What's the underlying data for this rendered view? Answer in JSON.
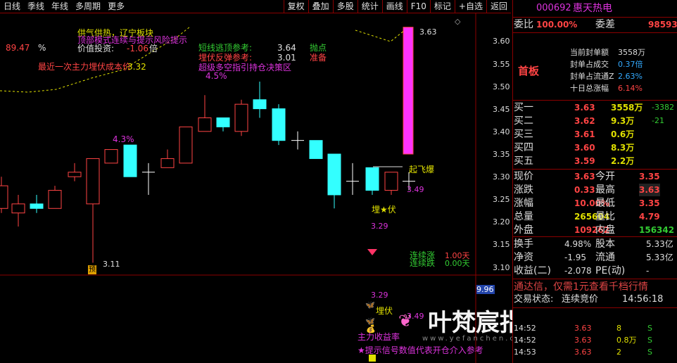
{
  "toolbar": {
    "left": [
      "日线",
      "季线",
      "年线",
      "多周期",
      "更多"
    ],
    "right": [
      "复权",
      "叠加",
      "多股",
      "统计",
      "画线",
      "F10",
      "标记",
      "+自选",
      "返回"
    ]
  },
  "overlay_text": {
    "l1": "供气供热，辽宁板块",
    "l2": "顶部模式连续与提示风险提示",
    "l3_label": "价值投资:",
    "l3_value": "-1.06",
    "l3_unit": "倍",
    "left_num": "89.47",
    "left_pct": "%",
    "cost": "最近一次主力埋伏成本价",
    "cost_val": "3.32",
    "s1_label": "短线逃顶参考:",
    "s1_val": "3.64",
    "s1_tag": "抛点",
    "s2_label": "埋伏反弹参考:",
    "s2_val": "3.01",
    "s2_tag": "准备",
    "s3": "超级多空指引持仓决策区",
    "pct1": "4.5%",
    "pct2": "4.3%",
    "high_label": "3.63",
    "low_label": "3.11",
    "qifei": "起飞爆",
    "v349": "3.49",
    "maifu": "埋★伏",
    "v329": "3.29",
    "lianxuzhang": "连续涨",
    "lianxuzhang_v": "1.00天",
    "lianxudie": "连续跌",
    "lianxudie_v": "0.00天",
    "yu": "预",
    "lower_v329": "3.29",
    "lower_maifu": "埋伏",
    "lower_349": "3.49",
    "zhushou": "主力收益率",
    "tips": "★提示信号数值代表开仓介入参考",
    "right_low": "9.96",
    "watermark": "叶梵宸指标公式网",
    "watermark_url": "www.yefanchen.com"
  },
  "yaxis": [
    "3.60",
    "3.55",
    "3.50",
    "3.45",
    "3.40",
    "3.35",
    "3.30",
    "3.25",
    "3.20",
    "3.15",
    "3.10"
  ],
  "panel": {
    "code": "000692",
    "name": "惠天热电",
    "weibi_label": "委比",
    "weibi": "100.00%",
    "weicha_label": "委差",
    "weicha": "98593",
    "shouban": "首板",
    "info": [
      {
        "k": "当前封单额",
        "v": "3558万"
      },
      {
        "k": "封单占成交",
        "v": "0.37倍"
      },
      {
        "k": "封单占流通Z",
        "v": "2.63%"
      },
      {
        "k": "十日总涨幅",
        "v": "6.14%"
      }
    ],
    "buys": [
      {
        "k": "买一",
        "p": "3.63",
        "v": "3558万",
        "d": "-3382"
      },
      {
        "k": "买二",
        "p": "3.62",
        "v": "9.3万",
        "d": "-21"
      },
      {
        "k": "买三",
        "p": "3.61",
        "v": "0.6万",
        "d": ""
      },
      {
        "k": "买四",
        "p": "3.60",
        "v": "8.3万",
        "d": ""
      },
      {
        "k": "买五",
        "p": "3.59",
        "v": "2.2万",
        "d": ""
      }
    ],
    "stats": [
      {
        "a": "现价",
        "av": "3.63",
        "b": "今开",
        "bv": "3.35"
      },
      {
        "a": "涨跌",
        "av": "0.33",
        "b": "最高",
        "bv": "3.63"
      },
      {
        "a": "涨幅",
        "av": "10.00%",
        "b": "最低",
        "bv": "3.35"
      },
      {
        "a": "总量",
        "av": "265604",
        "b": "量比",
        "bv": "4.79"
      },
      {
        "a": "外盘",
        "av": "109262",
        "b": "内盘",
        "bv": "156342"
      }
    ],
    "stats2": [
      {
        "a": "换手",
        "av": "4.98%",
        "b": "股本",
        "bv": "5.33亿"
      },
      {
        "a": "净资",
        "av": "-1.95",
        "b": "流通",
        "bv": "5.33亿"
      },
      {
        "a": "收益(二)",
        "av": "-2.078",
        "b": "PE(动)",
        "bv": "-"
      }
    ],
    "promo": "通达信，仅需1元查看千档行情",
    "trade_label": "交易状态:",
    "trade_state": "连续竞价",
    "trade_time": "14:56:18",
    "ticks": [
      {
        "t": "14:52",
        "p": "3.63",
        "v": "8",
        "f": "S"
      },
      {
        "t": "14:52",
        "p": "3.63",
        "v": "0.8万",
        "f": "S"
      },
      {
        "t": "14:53",
        "p": "3.63",
        "v": "2",
        "f": "S"
      }
    ]
  },
  "chart_data": {
    "type": "candlestick",
    "ylim": [
      3.08,
      3.66
    ],
    "candles": [
      {
        "o": 3.23,
        "c": 3.28,
        "h": 3.3,
        "l": 3.22
      },
      {
        "o": 3.22,
        "c": 3.24,
        "h": 3.26,
        "l": 3.19
      },
      {
        "o": 3.24,
        "c": 3.23,
        "h": 3.26,
        "l": 3.22
      },
      {
        "o": 3.23,
        "c": 3.27,
        "h": 3.28,
        "l": 3.23
      },
      {
        "o": 3.3,
        "c": 3.31,
        "h": 3.33,
        "l": 3.29
      },
      {
        "o": 3.24,
        "c": 3.34,
        "h": 3.34,
        "l": 3.11
      },
      {
        "o": 3.33,
        "c": 3.36,
        "h": 3.36,
        "l": 3.33
      },
      {
        "o": 3.37,
        "c": 3.3,
        "h": 3.37,
        "l": 3.3
      },
      {
        "o": 3.31,
        "c": 3.31,
        "h": 3.33,
        "l": 3.26
      },
      {
        "o": 3.32,
        "c": 3.34,
        "h": 3.36,
        "l": 3.32
      },
      {
        "o": 3.33,
        "c": 3.41,
        "h": 3.41,
        "l": 3.33
      },
      {
        "o": 3.4,
        "c": 3.43,
        "h": 3.48,
        "l": 3.4
      },
      {
        "o": 3.43,
        "c": 3.41,
        "h": 3.43,
        "l": 3.4
      },
      {
        "o": 3.4,
        "c": 3.46,
        "h": 3.47,
        "l": 3.39
      },
      {
        "o": 3.47,
        "c": 3.45,
        "h": 3.51,
        "l": 3.43
      },
      {
        "o": 3.45,
        "c": 3.38,
        "h": 3.46,
        "l": 3.37
      },
      {
        "o": 3.38,
        "c": 3.38,
        "h": 3.4,
        "l": 3.36
      },
      {
        "o": 3.38,
        "c": 3.34,
        "h": 3.38,
        "l": 3.34
      },
      {
        "o": 3.35,
        "c": 3.26,
        "h": 3.35,
        "l": 3.23
      },
      {
        "o": 3.29,
        "c": 3.29,
        "h": 3.33,
        "l": 3.26
      },
      {
        "o": 3.32,
        "c": 3.27,
        "h": 3.32,
        "l": 3.26
      },
      {
        "o": 3.27,
        "c": 3.31,
        "h": 3.31,
        "l": 3.26
      },
      {
        "o": 3.29,
        "c": 3.29,
        "h": 3.31,
        "l": 3.27
      },
      {
        "o": 3.35,
        "c": 3.63,
        "h": 3.63,
        "l": 3.35
      }
    ]
  }
}
